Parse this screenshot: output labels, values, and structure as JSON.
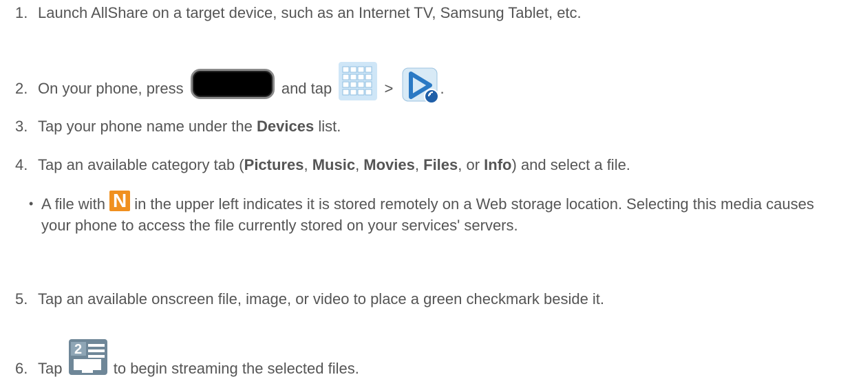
{
  "steps": [
    {
      "num": "1.",
      "text": "Launch AllShare on a target device, such as an Internet TV, Samsung Tablet, etc."
    },
    {
      "num": "2.",
      "text_a": "On your phone, press",
      "text_b": "and tap",
      "text_c": ">",
      "text_d": "."
    },
    {
      "num": "3.",
      "text_a": "Tap your phone name under the ",
      "bold_a": "Devices",
      "text_b": " list."
    },
    {
      "num": "4.",
      "text_a": "Tap an available category tab (",
      "bold_a": "Pictures",
      "sep1": ", ",
      "bold_b": "Music",
      "sep2": ", ",
      "bold_c": "Movies",
      "sep3": ", ",
      "bold_d": "Files",
      "sep4": ", or ",
      "bold_e": "Info",
      "text_b": ") and select a file."
    },
    {
      "num": "5.",
      "text": "Tap an available onscreen file, image, or video to place a green checkmark beside it."
    },
    {
      "num": "6.",
      "text_a": "Tap",
      "text_b": "to begin streaming the selected files."
    }
  ],
  "bullet": {
    "text_a": "A file with",
    "text_b": "in the upper left indicates it is stored remotely on a Web storage location. Selecting this media causes your phone to access the file currently stored on your services' servers."
  },
  "icons": {
    "home_key": "home-key-icon",
    "apps": "apps-grid-icon",
    "allshare": "allshare-play-icon",
    "n_badge": "N",
    "share": "share-devices-icon",
    "share_number": "2"
  },
  "colors": {
    "text": "#555555",
    "n_badge": "#f0901f",
    "apps_bg": "#cfe6f7"
  }
}
